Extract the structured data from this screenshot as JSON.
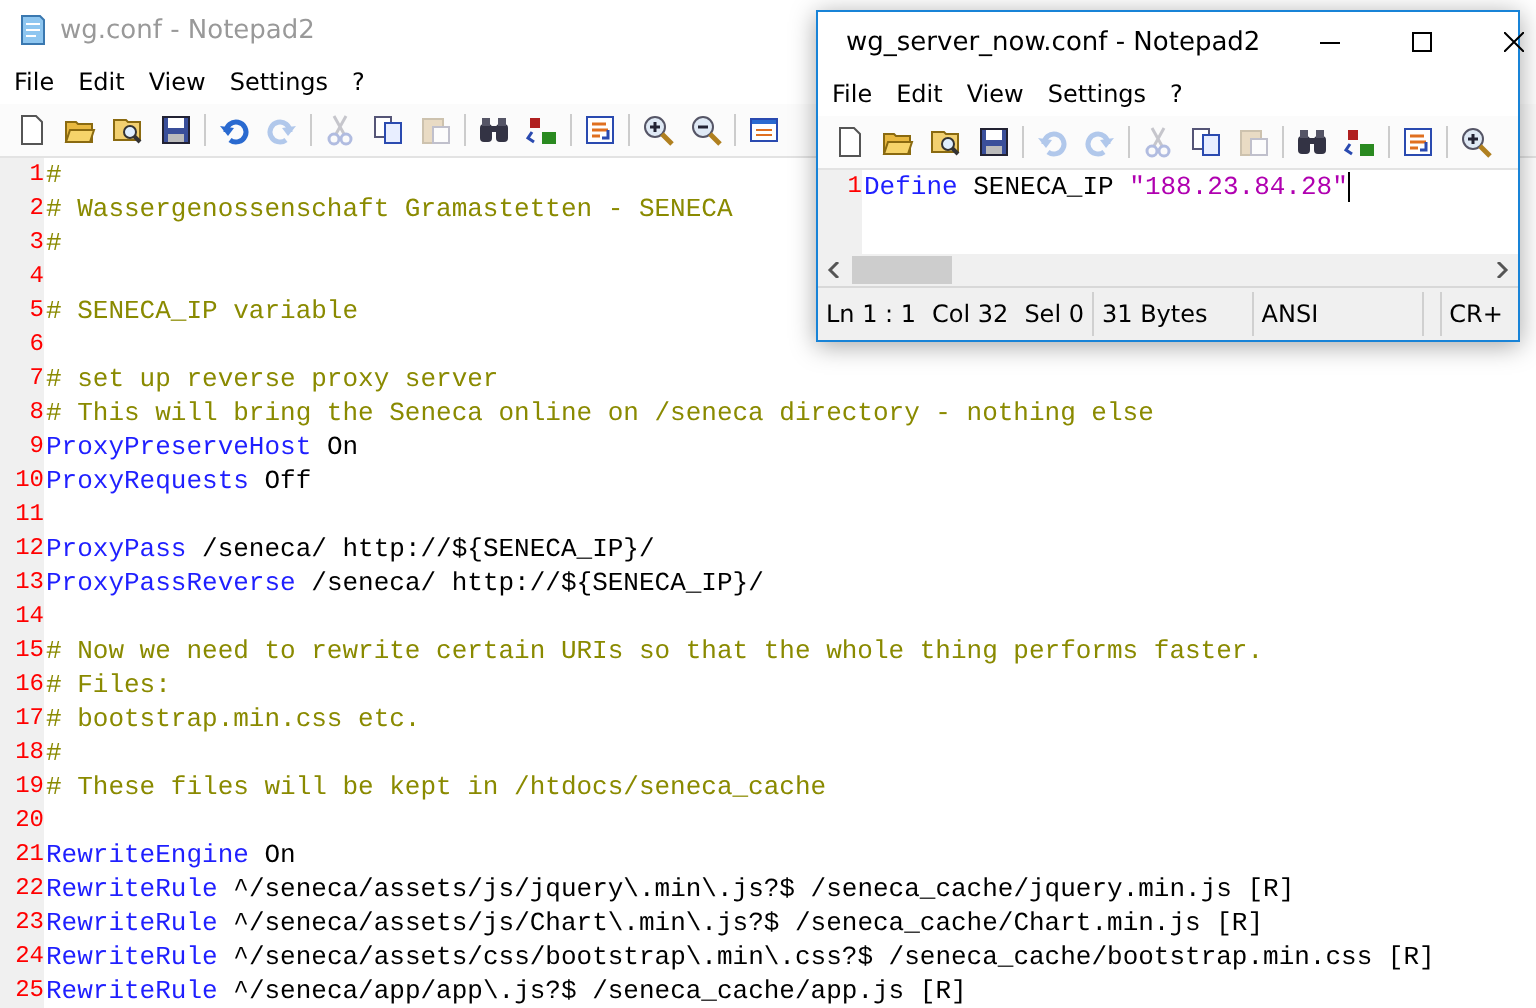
{
  "main_window": {
    "title": "wg.conf - Notepad2",
    "active": false,
    "menu": [
      "File",
      "Edit",
      "View",
      "Settings",
      "?"
    ],
    "toolbar_groups": [
      {
        "items": [
          {
            "kind": "new",
            "disabled": false
          },
          {
            "kind": "open",
            "disabled": false
          },
          {
            "kind": "browse",
            "disabled": false
          },
          {
            "kind": "save",
            "disabled": false
          }
        ]
      },
      {
        "items": [
          {
            "kind": "undo",
            "disabled": false
          },
          {
            "kind": "redo",
            "disabled": true
          }
        ]
      },
      {
        "items": [
          {
            "kind": "cut",
            "disabled": true
          },
          {
            "kind": "copy",
            "disabled": false
          },
          {
            "kind": "paste",
            "disabled": true
          }
        ]
      },
      {
        "items": [
          {
            "kind": "find",
            "disabled": false
          },
          {
            "kind": "replace",
            "disabled": false
          }
        ]
      },
      {
        "items": [
          {
            "kind": "wrap",
            "disabled": false
          }
        ]
      },
      {
        "items": [
          {
            "kind": "zoom-in",
            "disabled": false
          },
          {
            "kind": "zoom-out",
            "disabled": false
          }
        ]
      },
      {
        "items": [
          {
            "kind": "scheme",
            "disabled": false
          }
        ]
      }
    ],
    "lines": [
      {
        "number": "1",
        "tokens": [
          {
            "kind": "comment",
            "text": "#"
          }
        ]
      },
      {
        "number": "2",
        "tokens": [
          {
            "kind": "comment",
            "text": "# Wassergenossenschaft Gramastetten - SENECA"
          }
        ]
      },
      {
        "number": "3",
        "tokens": [
          {
            "kind": "comment",
            "text": "#"
          }
        ]
      },
      {
        "number": "4"
      },
      {
        "number": "5",
        "tokens": [
          {
            "kind": "comment",
            "text": "# SENECA_IP variable"
          }
        ]
      },
      {
        "number": "6"
      },
      {
        "number": "7",
        "tokens": [
          {
            "kind": "comment",
            "text": "# set up reverse proxy server"
          }
        ]
      },
      {
        "number": "8",
        "tokens": [
          {
            "kind": "comment",
            "text": "# This will bring the Seneca online on /seneca directory - nothing else"
          }
        ]
      },
      {
        "number": "9",
        "tokens": [
          {
            "kind": "keyword",
            "text": "ProxyPreserveHost"
          },
          {
            "kind": "text",
            "text": "On"
          }
        ]
      },
      {
        "number": "10",
        "tokens": [
          {
            "kind": "keyword",
            "text": "ProxyRequests"
          },
          {
            "kind": "text",
            "text": "Off"
          }
        ]
      },
      {
        "number": "11"
      },
      {
        "number": "12",
        "tokens": [
          {
            "kind": "keyword",
            "text": "ProxyPass"
          },
          {
            "kind": "text",
            "text": "/seneca/ http://${SENECA_IP}/"
          }
        ]
      },
      {
        "number": "13",
        "tokens": [
          {
            "kind": "keyword",
            "text": "ProxyPassReverse"
          },
          {
            "kind": "text",
            "text": "/seneca/ http://${SENECA_IP}/"
          }
        ]
      },
      {
        "number": "14"
      },
      {
        "number": "15",
        "tokens": [
          {
            "kind": "comment",
            "text": "# Now we need to rewrite certain URIs so that the whole thing performs faster."
          }
        ]
      },
      {
        "number": "16",
        "tokens": [
          {
            "kind": "comment",
            "text": "# Files:"
          }
        ]
      },
      {
        "number": "17",
        "tokens": [
          {
            "kind": "comment",
            "text": "# bootstrap.min.css etc."
          }
        ]
      },
      {
        "number": "18",
        "tokens": [
          {
            "kind": "comment",
            "text": "#"
          }
        ]
      },
      {
        "number": "19",
        "tokens": [
          {
            "kind": "comment",
            "text": "# These files will be kept in /htdocs/seneca_cache"
          }
        ]
      },
      {
        "number": "20"
      },
      {
        "number": "21",
        "tokens": [
          {
            "kind": "keyword",
            "text": "RewriteEngine"
          },
          {
            "kind": "text",
            "text": "On"
          }
        ]
      },
      {
        "number": "22",
        "tokens": [
          {
            "kind": "keyword",
            "text": "RewriteRule"
          },
          {
            "kind": "text",
            "text": "^/seneca/assets/js/jquery\\.min\\.js?$ /seneca_cache/jquery.min.js [R]"
          }
        ]
      },
      {
        "number": "23",
        "tokens": [
          {
            "kind": "keyword",
            "text": "RewriteRule"
          },
          {
            "kind": "text",
            "text": "^/seneca/assets/js/Chart\\.min\\.js?$ /seneca_cache/Chart.min.js [R]"
          }
        ]
      },
      {
        "number": "24",
        "tokens": [
          {
            "kind": "keyword",
            "text": "RewriteRule"
          },
          {
            "kind": "text",
            "text": "^/seneca/assets/css/bootstrap\\.min\\.css?$ /seneca_cache/bootstrap.min.css [R]"
          }
        ]
      },
      {
        "number": "25",
        "tokens": [
          {
            "kind": "keyword",
            "text": "RewriteRule"
          },
          {
            "kind": "text",
            "text": "^/seneca/app/app\\.js?$ /seneca_cache/app.js [R]"
          }
        ]
      }
    ]
  },
  "front_window": {
    "title": "wg_server_now.conf - Notepad2",
    "active": true,
    "menu": [
      "File",
      "Edit",
      "View",
      "Settings",
      "?"
    ],
    "toolbar_groups": [
      {
        "items": [
          {
            "kind": "new",
            "disabled": false
          },
          {
            "kind": "open",
            "disabled": false
          },
          {
            "kind": "browse",
            "disabled": false
          },
          {
            "kind": "save",
            "disabled": false
          }
        ]
      },
      {
        "items": [
          {
            "kind": "undo",
            "disabled": true
          },
          {
            "kind": "redo",
            "disabled": true
          }
        ]
      },
      {
        "items": [
          {
            "kind": "cut",
            "disabled": true
          },
          {
            "kind": "copy",
            "disabled": false
          },
          {
            "kind": "paste",
            "disabled": true
          }
        ]
      },
      {
        "items": [
          {
            "kind": "find",
            "disabled": false
          },
          {
            "kind": "replace",
            "disabled": false
          }
        ]
      },
      {
        "items": [
          {
            "kind": "wrap",
            "disabled": false
          }
        ]
      },
      {
        "items": [
          {
            "kind": "zoom-in",
            "disabled": false
          }
        ]
      }
    ],
    "lines": [
      {
        "number": "1",
        "tokens": [
          {
            "kind": "keyword",
            "text": "Define"
          },
          {
            "kind": "text",
            "text": "SENECA_IP"
          },
          {
            "kind": "string",
            "text": "\"188.23.84.28\""
          }
        ]
      }
    ],
    "status_bar": [
      "Ln 1 : 1",
      "Col 32",
      "Sel 0",
      "31 Bytes",
      "ANSI",
      "CR+"
    ]
  }
}
